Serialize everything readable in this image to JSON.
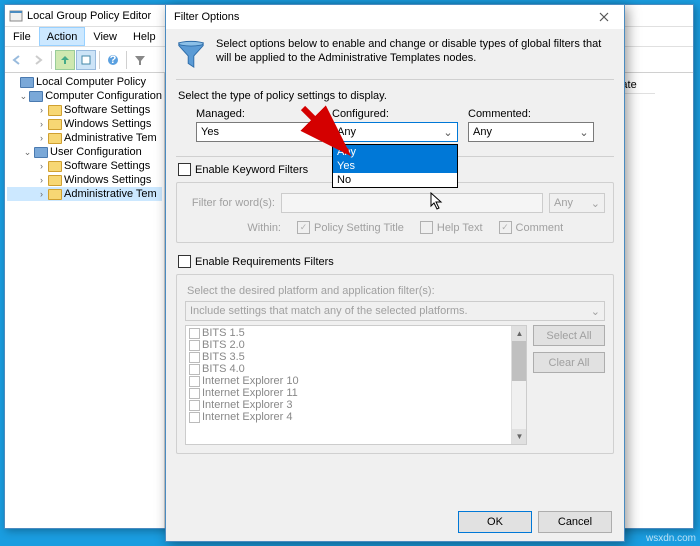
{
  "gpedit": {
    "title": "Local Group Policy Editor",
    "menus": [
      "File",
      "Action",
      "View",
      "Help"
    ],
    "selected_menu": 1,
    "tree": [
      {
        "indent": 0,
        "exp": "",
        "icon": "policy",
        "label": "Local Computer Policy"
      },
      {
        "indent": 1,
        "exp": "v",
        "icon": "comp",
        "label": "Computer Configuration"
      },
      {
        "indent": 2,
        "exp": ">",
        "icon": "folder",
        "label": "Software Settings"
      },
      {
        "indent": 2,
        "exp": ">",
        "icon": "folder",
        "label": "Windows Settings"
      },
      {
        "indent": 2,
        "exp": ">",
        "icon": "folder",
        "label": "Administrative Tem"
      },
      {
        "indent": 1,
        "exp": "v",
        "icon": "user",
        "label": "User Configuration"
      },
      {
        "indent": 2,
        "exp": ">",
        "icon": "folder",
        "label": "Software Settings"
      },
      {
        "indent": 2,
        "exp": ">",
        "icon": "folder",
        "label": "Windows Settings"
      },
      {
        "indent": 2,
        "exp": ">",
        "icon": "folder",
        "label": "Administrative Tem",
        "sel": true
      }
    ],
    "column_header": "State"
  },
  "dialog": {
    "title": "Filter Options",
    "desc": "Select options below to enable and change or disable types of global filters that will be applied to the Administrative Templates nodes.",
    "sub": "Select the type of policy settings to display.",
    "filters": {
      "managed": {
        "label": "Managed:",
        "value": "Yes"
      },
      "configured": {
        "label": "Configured:",
        "value": "Any",
        "options": [
          "Any",
          "Yes",
          "No"
        ],
        "highlight": 1
      },
      "commented": {
        "label": "Commented:",
        "value": "Any"
      }
    },
    "keyword": {
      "enable": "Enable Keyword Filters",
      "filter_for": "Filter for word(s):",
      "combo": "Any",
      "within": "Within:",
      "opt1": "Policy Setting Title",
      "opt2": "Help Text",
      "opt3": "Comment"
    },
    "requirements": {
      "enable": "Enable Requirements Filters",
      "label": "Select the desired platform and application filter(s):",
      "combo": "Include settings that match any of the selected platforms.",
      "items": [
        "BITS 1.5",
        "BITS 2.0",
        "BITS 3.5",
        "BITS 4.0",
        "Internet Explorer 10",
        "Internet Explorer 11",
        "Internet Explorer 3",
        "Internet Explorer 4"
      ],
      "select_all": "Select All",
      "clear_all": "Clear All"
    },
    "ok": "OK",
    "cancel": "Cancel"
  },
  "watermark": "wsxdn.com"
}
